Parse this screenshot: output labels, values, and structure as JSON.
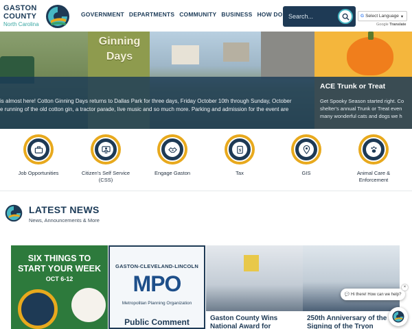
{
  "header": {
    "logo": {
      "line1": "GASTON",
      "line2": "COUNTY",
      "sub": "North Carolina"
    },
    "nav": [
      "GOVERNMENT",
      "DEPARTMENTS",
      "COMMUNITY",
      "BUSINESS",
      "HOW DO I..."
    ],
    "search": {
      "placeholder": "Search..."
    },
    "language": {
      "selected": "Select Language",
      "powered_by": "Google",
      "powered_product": "Translate"
    }
  },
  "hero": {
    "slide1": {
      "title": "Ginning Days",
      "text_line1": "is almost here! Cotton Ginning Days returns to Dallas Park for three days, Friday October 10th through Sunday, October",
      "text_line2": "e running of the old cotton gin, a tractor parade, live music and so much more. Parking and admission for the event are"
    },
    "slide2": {
      "title": "ACE Trunk or Treat",
      "text_line1": "Get Spooky Season started right. Co",
      "text_line2": "shelter's annual Trunk or Treat even",
      "text_line3": "many wonderful cats and dogs we h"
    }
  },
  "quick_links": [
    {
      "label": "Job Opportunities",
      "icon": "briefcase-icon"
    },
    {
      "label_line1": "Citizen's Self Service",
      "label_line2": "(CSS)",
      "icon": "self-service-icon"
    },
    {
      "label": "Engage Gaston",
      "icon": "handshake-icon"
    },
    {
      "label": "Tax",
      "icon": "tax-document-icon"
    },
    {
      "label": "GIS",
      "icon": "map-pin-icon"
    },
    {
      "label_line1": "Animal Care &",
      "label_line2": "Enforcement",
      "icon": "paw-icon"
    }
  ],
  "news": {
    "title": "LATEST NEWS",
    "subtitle": "News, Announcements & More",
    "cards": [
      {
        "big_line1": "SIX THINGS TO",
        "big_line2": "START YOUR WEEK",
        "date": "OCT 6-12"
      },
      {
        "org": "GASTON-CLEVELAND-LINCOLN",
        "logo": "MPO",
        "logo_sub": "Metropolitan Planning Organization",
        "caption": "Public Comment"
      },
      {
        "caption_line1": "Gaston County Wins",
        "caption_line2": "National Award for"
      },
      {
        "caption_line1": "250th Anniversary of the",
        "caption_line2": "Signing of the Tryon"
      }
    ]
  },
  "chat": {
    "prompt": "Hi there! How can we help?",
    "close": "×"
  },
  "colors": {
    "navy": "#1e3a55",
    "gold": "#e8a91d",
    "teal": "#47b8c4",
    "green": "#2d7a3c"
  }
}
